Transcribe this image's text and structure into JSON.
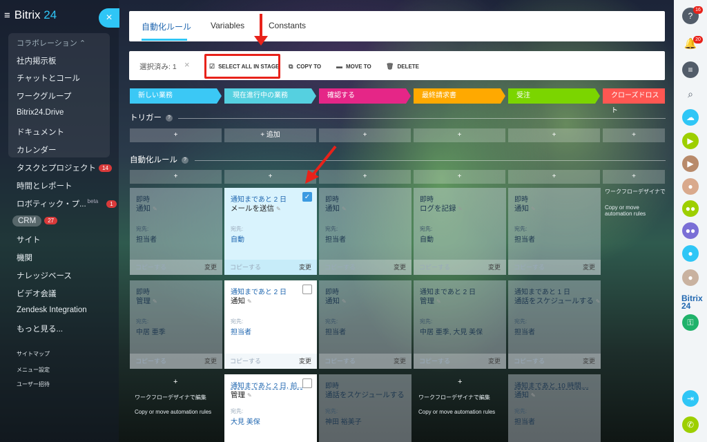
{
  "sidebar": {
    "logo_prefix": "Bitrix",
    "logo_num": "24",
    "close_glyph": "×",
    "group_header": "コラボレーション ⌃",
    "items": [
      {
        "label": "社内掲示板"
      },
      {
        "label": "チャットとコール"
      },
      {
        "label": "ワークグループ"
      },
      {
        "label": "Bitrix24.Drive"
      },
      {
        "label": "ドキュメント"
      },
      {
        "label": "カレンダー"
      },
      {
        "label": "タスクとプロジェクト",
        "badge": "14"
      },
      {
        "label": "時間とレポート"
      },
      {
        "label": "ロボティック・プ...",
        "beta": "beta",
        "badge": "1"
      },
      {
        "label": "CRM",
        "badge": "27"
      },
      {
        "label": "サイト"
      },
      {
        "label": "機関"
      },
      {
        "label": "ナレッジベース"
      },
      {
        "label": "ビデオ会議"
      },
      {
        "label": "Zendesk Integration"
      },
      {
        "label": "もっと見る..."
      }
    ],
    "footer": [
      "サイトマップ",
      "メニュー設定",
      "ユーザー招待"
    ]
  },
  "tabs": [
    "自動化ルール",
    "Variables",
    "Constants"
  ],
  "toolbar": {
    "selected": "選択済み: 1",
    "clear": "×",
    "select_all": "SELECT ALL IN STAGE",
    "copy": "COPY TO",
    "move": "MOVE TO",
    "delete": "DELETE"
  },
  "stages": [
    {
      "label": "新しい業務",
      "color": "#3bc8f5"
    },
    {
      "label": "現在進行中の業務",
      "color": "#55d0e0"
    },
    {
      "label": "確認する",
      "color": "#e52687"
    },
    {
      "label": "最終請求書",
      "color": "#ffa900"
    },
    {
      "label": "受注",
      "color": "#7bd500"
    },
    {
      "label": "クローズドロスト",
      "color": "#ff5752"
    }
  ],
  "sections": {
    "triggers": "トリガー",
    "rules": "自動化ルール",
    "help": "?"
  },
  "add_label": "+ 追加",
  "plus": "+",
  "card_common": {
    "to_label": "宛先:",
    "copy": "コピーする",
    "change": "変更"
  },
  "cards_row1": [
    {
      "when": "即時",
      "action": "通知",
      "to": "担当者"
    },
    {
      "when": "通知まであと 2 日",
      "action": "メールを送信",
      "to": "自動"
    },
    {
      "when": "即時",
      "action": "通知",
      "to": "担当者"
    },
    {
      "when": "即時",
      "action": "ログを記録",
      "to": "自動"
    },
    {
      "when": "即時",
      "action": "通知",
      "to": "担当者"
    }
  ],
  "cards_row2": [
    {
      "when": "即時",
      "action": "管理",
      "to": "中居 亜季"
    },
    {
      "when": "通知まであと 2 日",
      "action": "通知",
      "to": "担当者"
    },
    {
      "when": "即時",
      "action": "通知",
      "to": "担当者"
    },
    {
      "when": "通知まであと 2 日",
      "action": "管理",
      "to": "中居 亜季, 大見 美保"
    },
    {
      "when": "通知まであと 1 日",
      "action": "通話をスケジュールする",
      "to": "担当者"
    }
  ],
  "cards_row3": [
    {
      "when": "通知まであと 2 日, 前...",
      "action": "管理",
      "to": "大見 美保"
    },
    {
      "when": "即時",
      "action": "通話をスケジュールする",
      "to": "神田 裕美子"
    },
    {
      "when": "通知まであと 10 時間,...",
      "action": "通知",
      "to": "担当者"
    }
  ],
  "ghost": {
    "designer": "ワークフローデザイナで編集",
    "copymove": "Copy or move automation rules",
    "designer_short": "ワークフローデザイナで"
  },
  "right_bar": {
    "help_badge": "16",
    "bell_badge": "20",
    "b24_text": "Bitrix",
    "b24_num": "24"
  }
}
